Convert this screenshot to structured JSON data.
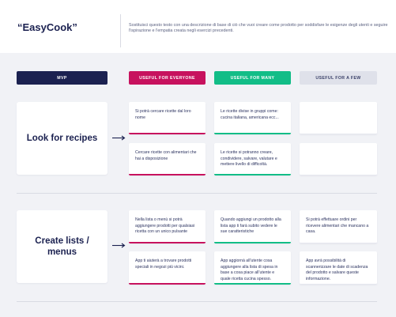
{
  "header": {
    "title": "“EasyCook”",
    "description": "Sostituisci questo testo con una descrizione di base di ciò che vuoi creare come prodotto per soddisfare le esigenze degli utenti e seguire l'ispirazione e l'empatia creata negli esercizi precedenti."
  },
  "columns": [
    {
      "label": "MVP"
    },
    {
      "label": "USEFUL FOR EVERYONE"
    },
    {
      "label": "USEFUL FOR MANY"
    },
    {
      "label": "USEFUL FOR A FEW"
    }
  ],
  "rows": [
    {
      "category": "Look for recipes",
      "cards": {
        "everyone": [
          "Si potrà cercare ricette dal loro nome",
          "Cercare ricette con alimentari che hai a disposizione"
        ],
        "many": [
          "Le ricette divise in gruppi come: cucina italiana, americana ecc...",
          "Le ricette si potranno creare, condividere, salvare, valutare e mettere livello di difficoltà."
        ],
        "few": [
          "",
          ""
        ]
      }
    },
    {
      "category": "Create lists / menus",
      "cards": {
        "everyone": [
          "Nella lista o menù si potrà aggiungere prodotti per qualsiasi ricetta con un unico pulsante",
          "App ti aiuterà a trovare prodotti speciali in negozi più vicini."
        ],
        "many": [
          "Quando aggiungi un prodotto alla lista app ti farà subito vedere le sue caratteristiche",
          "App aggiornà all'utente cosa aggiungere alla lista di spesa in base a cosa piace all'utente e quale ricetta cucina spesso."
        ],
        "few": [
          "Si potrà effettuare ordini per ricevere alimentari che mancano a casa.",
          "App avrà possibilità di scannerizzare le date di scadenza del prodotto e salvare queste informazione."
        ]
      }
    }
  ],
  "colors": {
    "mvp": "#1b2150",
    "everyone": "#c7125e",
    "many": "#12bd87",
    "few": "#dfe1ea"
  },
  "icons": {
    "row_arrow": "arrow-right-icon"
  }
}
